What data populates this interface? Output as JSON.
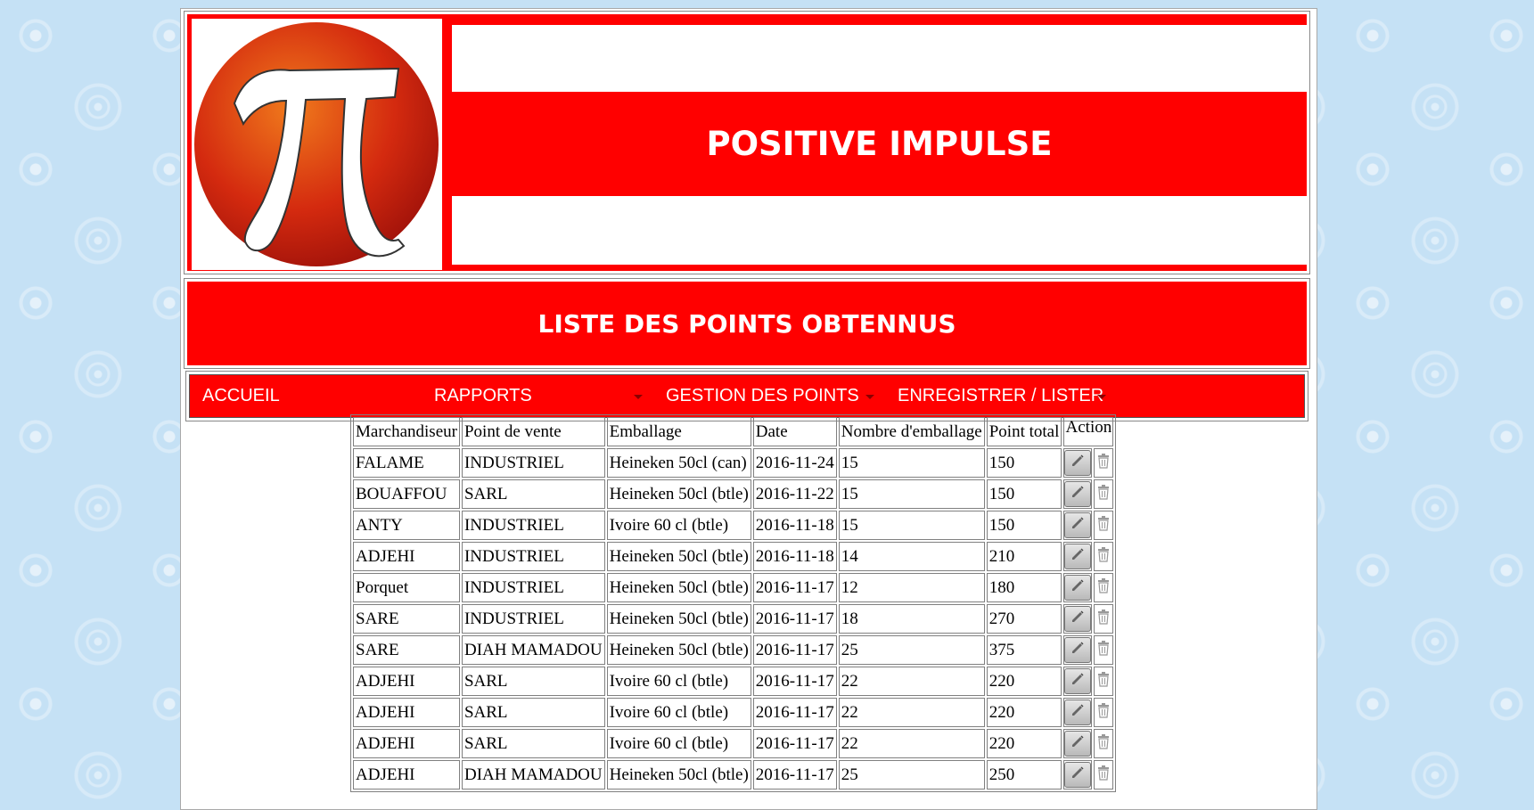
{
  "header": {
    "title": "POSITIVE IMPULSE",
    "logo_icon": "pi-logo-icon",
    "colors": {
      "brand_red": "#ff0000",
      "logo_orange": "#e8651a",
      "background": "#c5e1f5"
    }
  },
  "page_title": "LISTE DES POINTS OBTENNUS",
  "nav": {
    "items": [
      {
        "label": "ACCUEIL"
      },
      {
        "label": "RAPPORTS"
      },
      {
        "label": "GESTION DES POINTS"
      },
      {
        "label": "ENREGISTRER / LISTER"
      }
    ]
  },
  "table": {
    "columns": [
      "Marchandiseur",
      "Point de vente",
      "Emballage",
      "Date",
      "Nombre d'emballage",
      "Point total",
      "Action"
    ],
    "action_icons": [
      "pencil-icon",
      "trash-icon"
    ],
    "rows": [
      [
        "FALAME",
        "INDUSTRIEL",
        "Heineken 50cl (can)",
        "2016-11-24",
        "15",
        "150"
      ],
      [
        "BOUAFFOU",
        "SARL",
        "Heineken 50cl (btle)",
        "2016-11-22",
        "15",
        "150"
      ],
      [
        "ANTY",
        "INDUSTRIEL",
        "Ivoire 60 cl (btle)",
        "2016-11-18",
        "15",
        "150"
      ],
      [
        "ADJEHI",
        "INDUSTRIEL",
        "Heineken 50cl (btle)",
        "2016-11-18",
        "14",
        "210"
      ],
      [
        "Porquet",
        "INDUSTRIEL",
        "Heineken 50cl (btle)",
        "2016-11-17",
        "12",
        "180"
      ],
      [
        "SARE",
        "INDUSTRIEL",
        "Heineken 50cl (btle)",
        "2016-11-17",
        "18",
        "270"
      ],
      [
        "SARE",
        "DIAH MAMADOU",
        "Heineken 50cl (btle)",
        "2016-11-17",
        "25",
        "375"
      ],
      [
        "ADJEHI",
        "SARL",
        "Ivoire 60 cl (btle)",
        "2016-11-17",
        "22",
        "220"
      ],
      [
        "ADJEHI",
        "SARL",
        "Ivoire 60 cl (btle)",
        "2016-11-17",
        "22",
        "220"
      ],
      [
        "ADJEHI",
        "SARL",
        "Ivoire 60 cl (btle)",
        "2016-11-17",
        "22",
        "220"
      ],
      [
        "ADJEHI",
        "DIAH MAMADOU",
        "Heineken 50cl (btle)",
        "2016-11-17",
        "25",
        "250"
      ]
    ]
  }
}
